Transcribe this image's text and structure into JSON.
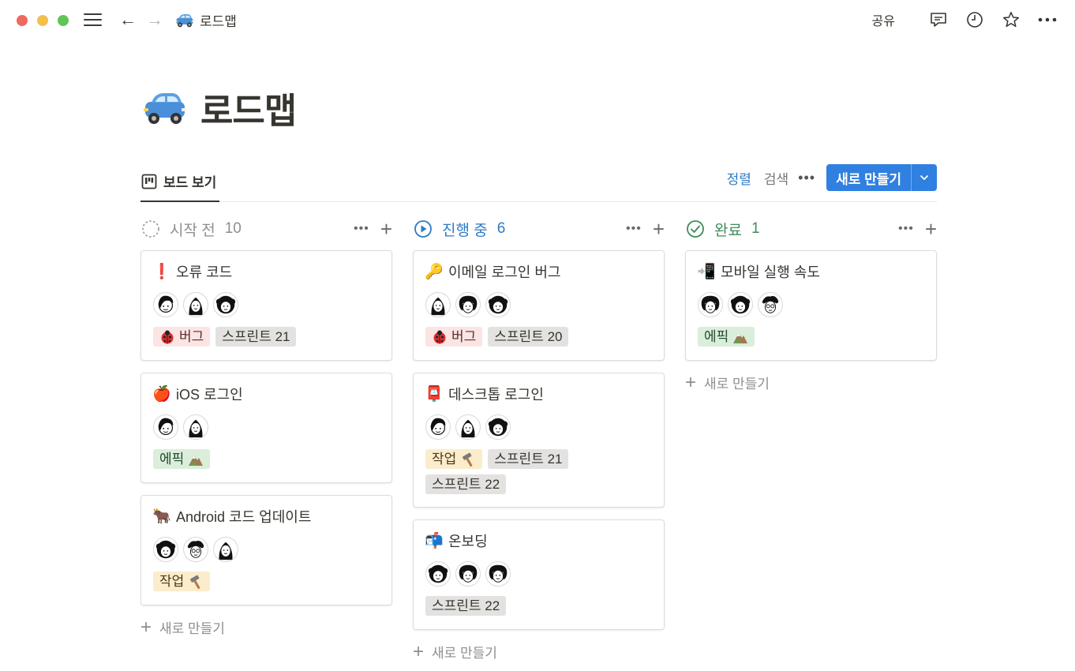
{
  "window": {
    "breadcrumb": "로드맵",
    "share_label": "공유",
    "icons": [
      "menu-icon",
      "back-arrow-icon",
      "forward-arrow-icon",
      "comment-icon",
      "history-clock-icon",
      "star-icon",
      "more-icon"
    ]
  },
  "page": {
    "title": "로드맵",
    "emoji": "car-icon"
  },
  "view": {
    "tab_label": "보드 보기",
    "sort_label": "정렬",
    "search_label": "검색",
    "more_label": "•••",
    "new_button_label": "새로 만들기"
  },
  "columns": [
    {
      "name": "시작 전",
      "count": "10",
      "status": "not-started",
      "color": "#8f8e8a",
      "more_label": "•••",
      "plus_label": "+",
      "add_label": "새로 만들기",
      "cards": [
        {
          "emoji": "❗",
          "title": "오류 코드",
          "tags": [
            {
              "label": "버그",
              "color": "red",
              "icon": "ladybug-icon"
            },
            {
              "label": "스프린트 21",
              "color": "gray"
            }
          ]
        },
        {
          "emoji": "🍎",
          "title": "iOS 로그인",
          "tags": [
            {
              "label": "에픽",
              "color": "green",
              "icon": "mountain-icon"
            }
          ]
        },
        {
          "emoji": "🐂",
          "title": "Android 코드 업데이트",
          "tags": [
            {
              "label": "작업",
              "color": "yellow",
              "icon": "hammer-icon"
            }
          ]
        }
      ]
    },
    {
      "name": "진행 중",
      "count": "6",
      "status": "in-progress",
      "color": "#2e7bc4",
      "more_label": "•••",
      "plus_label": "+",
      "add_label": "새로 만들기",
      "cards": [
        {
          "emoji": "🔑",
          "title": "이메일 로그인 버그",
          "tags": [
            {
              "label": "버그",
              "color": "red",
              "icon": "ladybug-icon"
            },
            {
              "label": "스프린트 20",
              "color": "gray"
            }
          ]
        },
        {
          "emoji": "📮",
          "title": "데스크톱 로그인",
          "tags": [
            {
              "label": "작업",
              "color": "yellow",
              "icon": "hammer-icon"
            },
            {
              "label": "스프린트 21",
              "color": "gray"
            },
            {
              "label": "스프린트 22",
              "color": "gray"
            }
          ]
        },
        {
          "emoji": "📬",
          "title": "온보딩",
          "tags": [
            {
              "label": "스프린트 22",
              "color": "gray"
            }
          ]
        }
      ]
    },
    {
      "name": "완료",
      "count": "1",
      "status": "done",
      "color": "#3f8d5c",
      "more_label": "•••",
      "plus_label": "+",
      "add_label": "새로 만들기",
      "cards": [
        {
          "emoji": "📲",
          "title": "모바일 실행 속도",
          "tags": [
            {
              "label": "에픽",
              "color": "green",
              "icon": "mountain-icon"
            }
          ]
        }
      ]
    }
  ]
}
